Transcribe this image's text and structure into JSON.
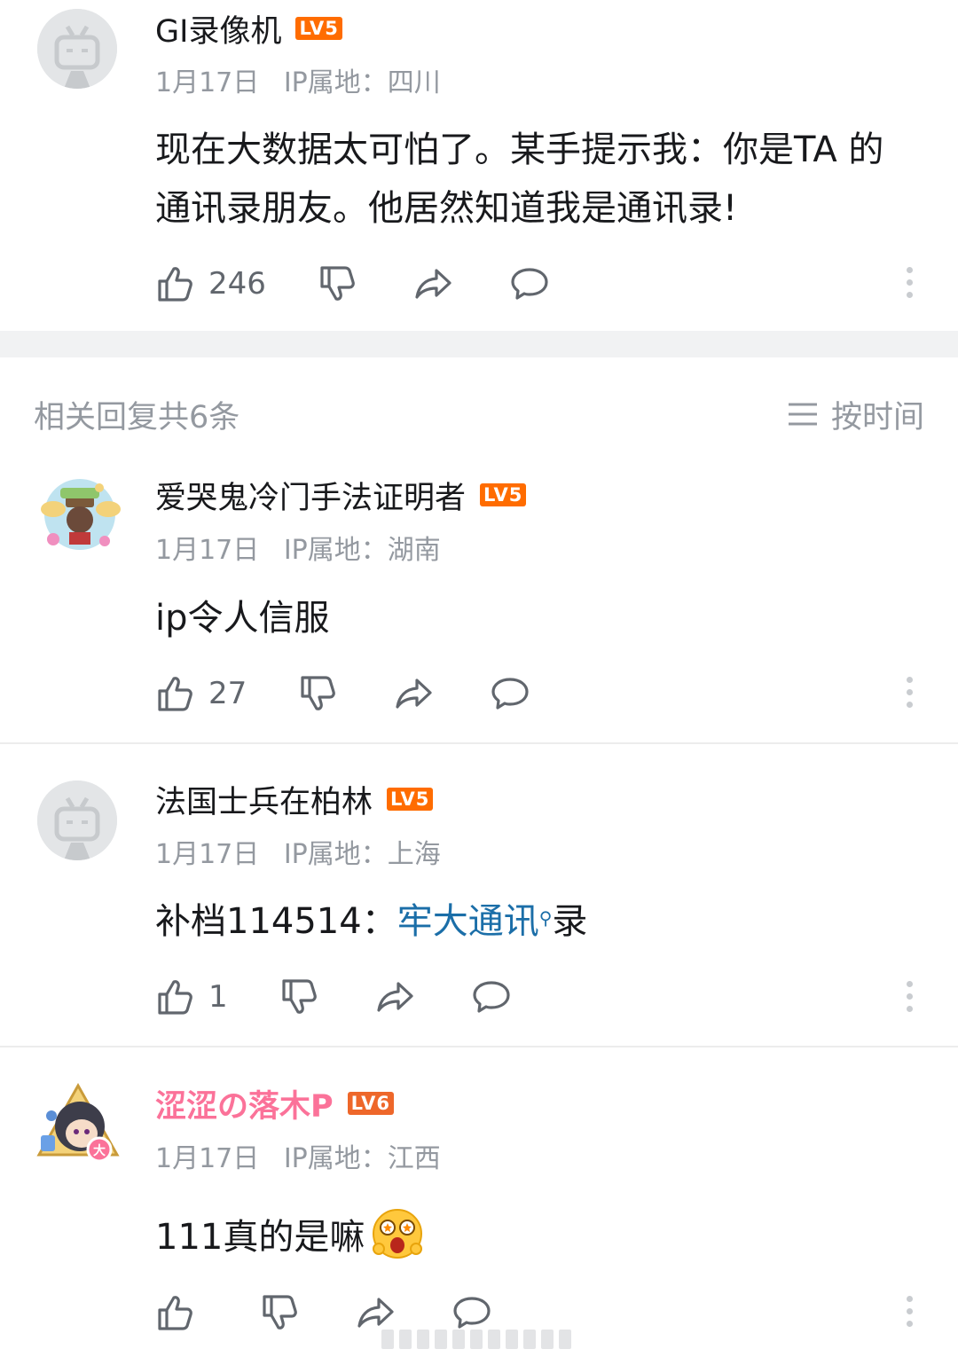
{
  "main_comment": {
    "username": "GI录像机",
    "level": "LV5",
    "date": "1月17日",
    "ip": "IP属地：四川",
    "text": "现在大数据太可怕了。某手提示我：你是TA 的通讯录朋友。他居然知道我是通讯录!",
    "likes": "246"
  },
  "replies_header": {
    "title": "相关回复共6条",
    "sort_label": "按时间"
  },
  "replies": [
    {
      "username": "爱哭鬼冷门手法证明者",
      "level": "LV5",
      "date": "1月17日",
      "ip": "IP属地：湖南",
      "text": "ip令人信服",
      "likes": "27"
    },
    {
      "username": "法国士兵在柏林",
      "level": "LV5",
      "date": "1月17日",
      "ip": "IP属地：上海",
      "text_prefix": "补档114514：",
      "text_link": "牢大通讯",
      "text_suffix": "录",
      "likes": "1"
    },
    {
      "username": "涩涩の落木P",
      "level": "LV6",
      "date": "1月17日",
      "ip": "IP属地：江西",
      "text": "111真的是嘛",
      "likes": ""
    }
  ],
  "colors": {
    "level_badge": "#ff6c00",
    "vip_name": "#fb7299",
    "link": "#1b6ea8",
    "meta": "#9499a0"
  },
  "icons": [
    "thumb-up-icon",
    "thumb-down-icon",
    "share-icon",
    "reply-icon",
    "more-icon",
    "sort-icon",
    "search-icon"
  ]
}
